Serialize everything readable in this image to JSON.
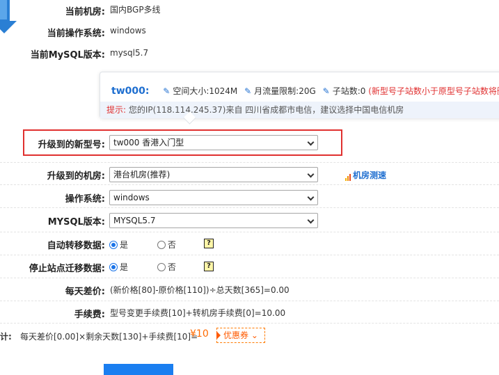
{
  "current": {
    "room_label": "当前机房:",
    "room_value": "国内BGP多线",
    "os_label": "当前操作系统:",
    "os_value": "windows",
    "mysql_label": "当前MySQL版本:",
    "mysql_value": "mysql5.7"
  },
  "tooltip": {
    "model": "tw000:",
    "space": "空间大小:1024M",
    "traffic": "月流量限制:20G",
    "subsites": "子站数:0",
    "subsites_warning": "(新型号子站数小于原型号子站数将删",
    "hint_label": "提示:",
    "hint_text": "您的IP(118.114.245.37)来自 四川省成都市电信，建议选择中国电信机房"
  },
  "form": {
    "model_label": "升级到的新型号:",
    "model_value": "tw000 香港入门型",
    "room_label": "升级到的机房:",
    "room_value": "港台机房(推荐)",
    "speed_test": "机房测速",
    "os_label": "操作系统:",
    "os_value": "windows",
    "mysql_label": "MYSQL版本:",
    "mysql_value": "MYSQL5.7",
    "auto_transfer_label": "自动转移数据:",
    "stop_site_label": "停止站点迁移数据:",
    "yes": "是",
    "no": "否",
    "help": "?",
    "daily_diff_label": "每天差价:",
    "daily_diff_value": "(新价格[80]-原价格[110])÷总天数[365]=0.00",
    "fee_label": "手续费:",
    "fee_value": "型号变更手续费[10]+转机房手续费[0]=10.00"
  },
  "total": {
    "label": "计:",
    "formula": "每天差价[0.00]×剩余天数[130]+手续费[10]=",
    "price": "¥10",
    "coupon": "优惠券"
  },
  "colors": {
    "accent": "#1f6fd0",
    "highlight_box": "#e0302f",
    "price": "#ff6a00"
  }
}
